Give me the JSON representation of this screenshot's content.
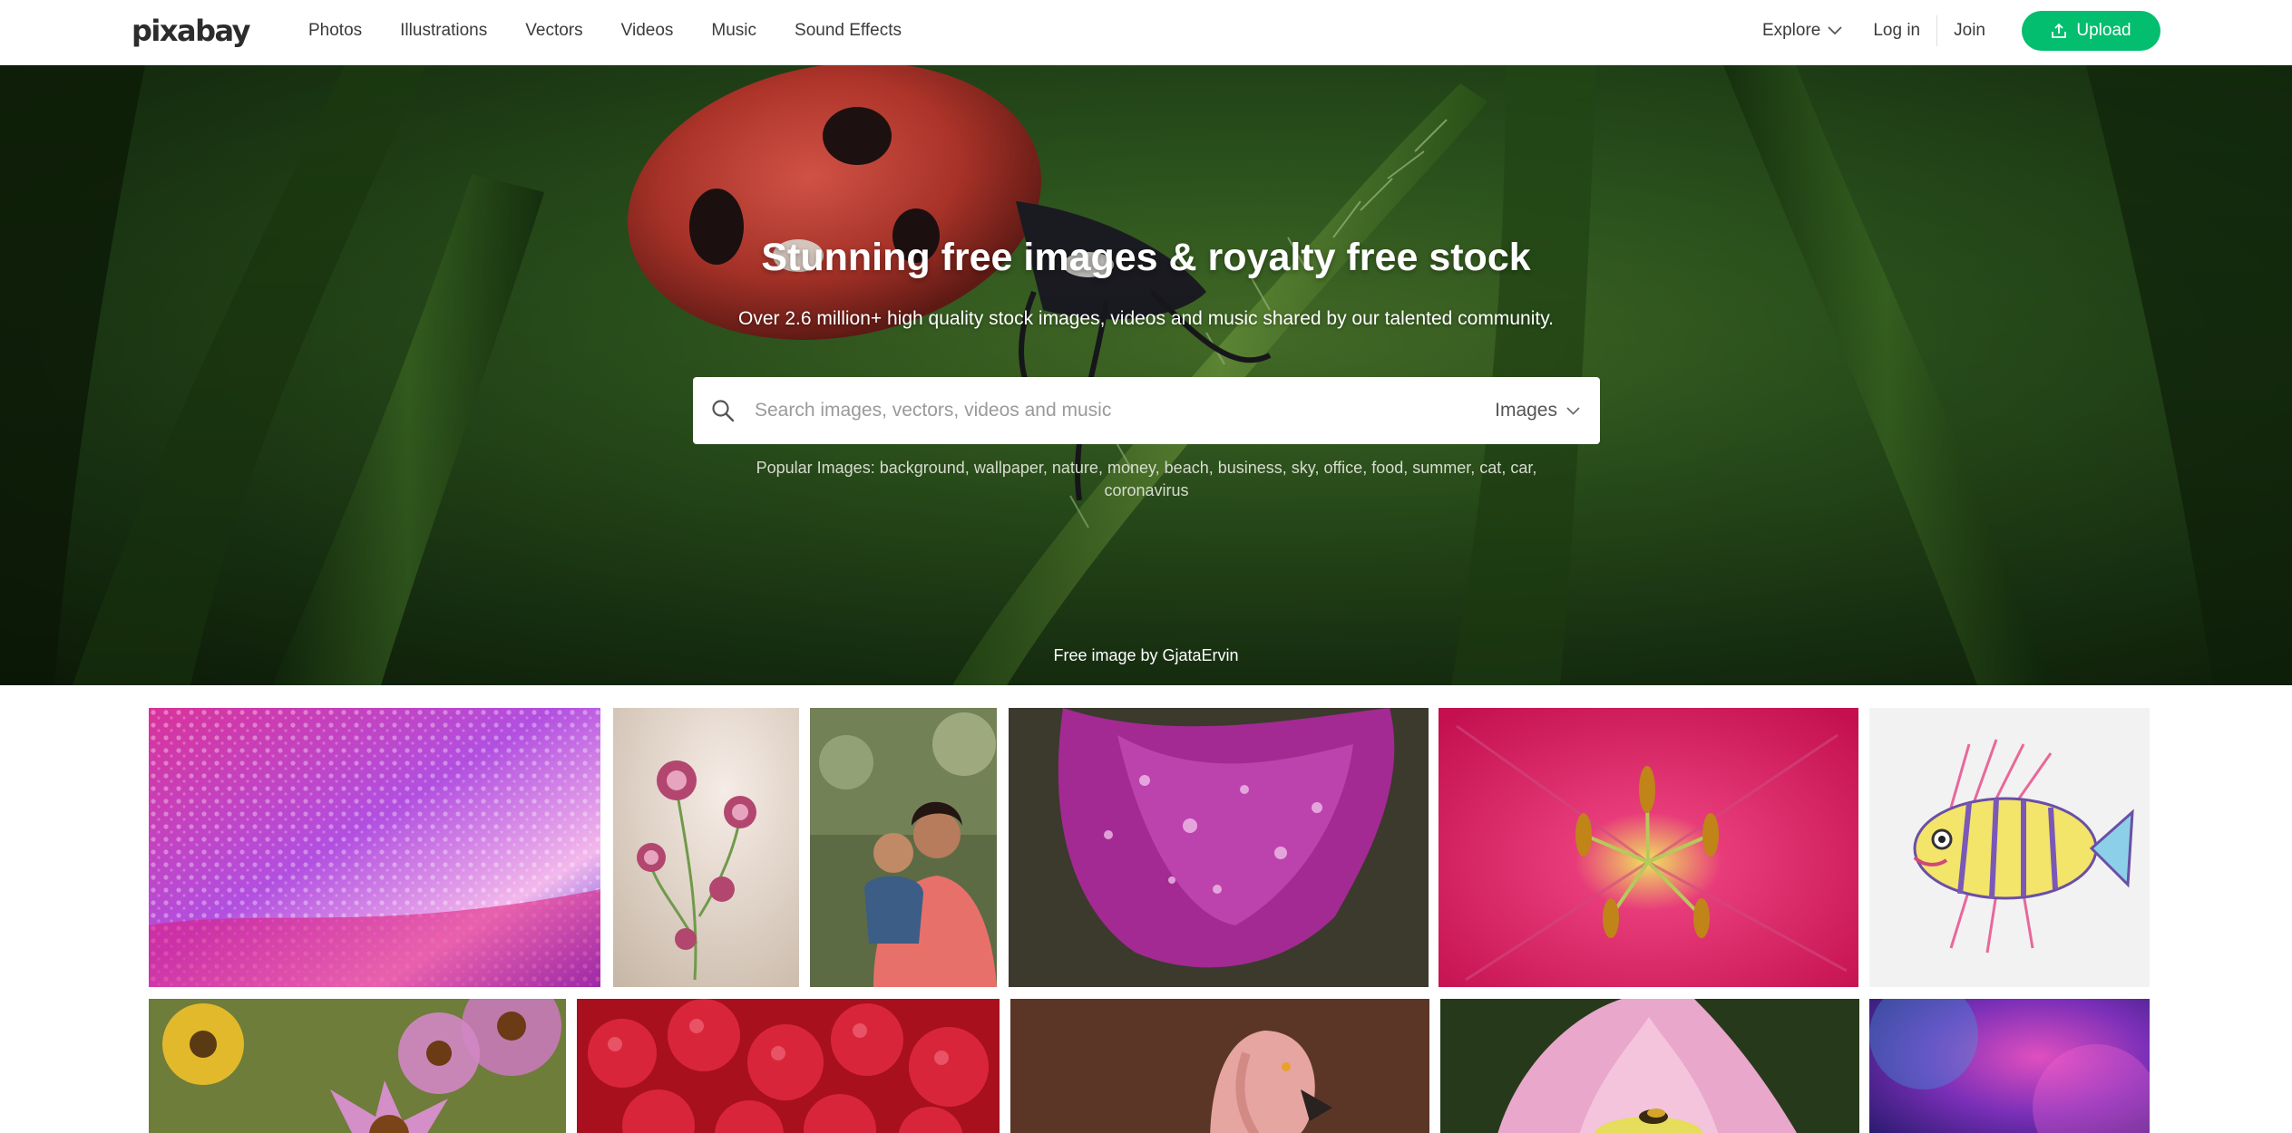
{
  "header": {
    "logo": "pixabay",
    "nav": [
      {
        "label": "Photos",
        "name": "nav-photos"
      },
      {
        "label": "Illustrations",
        "name": "nav-illustrations"
      },
      {
        "label": "Vectors",
        "name": "nav-vectors"
      },
      {
        "label": "Videos",
        "name": "nav-videos"
      },
      {
        "label": "Music",
        "name": "nav-music"
      },
      {
        "label": "Sound Effects",
        "name": "nav-sound-effects"
      }
    ],
    "explore_label": "Explore",
    "login_label": "Log in",
    "join_label": "Join",
    "upload_label": "Upload"
  },
  "hero": {
    "title": "Stunning free images & royalty free stock",
    "subtitle": "Over 2.6 million+ high quality stock images, videos and music shared by our talented community.",
    "search": {
      "placeholder": "Search images, vectors, videos and music",
      "type_label": "Images"
    },
    "popular_prefix": "Popular Images:",
    "popular_tags": [
      "background",
      "wallpaper",
      "nature",
      "money",
      "beach",
      "business",
      "sky",
      "office",
      "food",
      "summer",
      "cat",
      "car",
      "coronavirus"
    ],
    "credit": "Free image by GjataErvin"
  },
  "colors": {
    "accent": "#02be6e",
    "header_bg": "#ffffff",
    "hero_green": "#2f5a1f"
  },
  "icons": [
    "search-icon",
    "chevron-down-icon",
    "upload-icon"
  ],
  "gallery": {
    "tiles": [
      {
        "name": "gallery-tile-water-drops-gradient"
      },
      {
        "name": "gallery-tile-pink-flowers"
      },
      {
        "name": "gallery-tile-mother-and-child"
      },
      {
        "name": "gallery-tile-purple-petal-drops"
      },
      {
        "name": "gallery-tile-red-lily"
      },
      {
        "name": "gallery-tile-lionfish-illustration"
      },
      {
        "name": "gallery-tile-coneflowers"
      },
      {
        "name": "gallery-tile-raspberries"
      },
      {
        "name": "gallery-tile-flamingo"
      },
      {
        "name": "gallery-tile-lotus-bee"
      },
      {
        "name": "gallery-tile-colorful-smoke"
      }
    ]
  }
}
